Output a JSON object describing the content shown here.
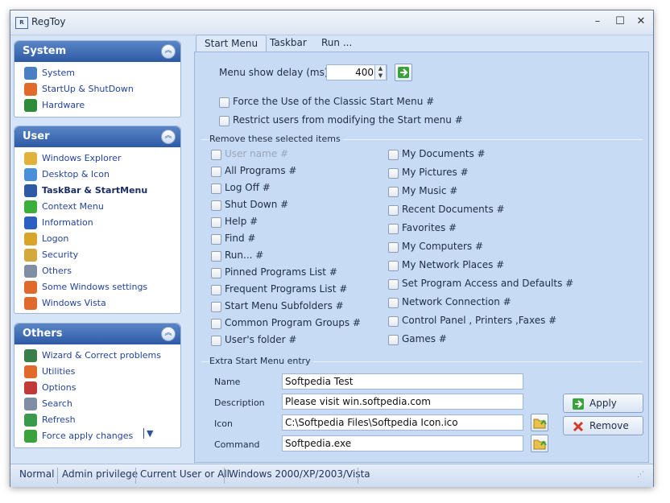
{
  "window": {
    "title": "RegToy",
    "icon_text": "R",
    "controls": {
      "minimize": "–",
      "maximize": "☐",
      "close": "✕"
    }
  },
  "sidebar": {
    "system": {
      "title": "System",
      "items": [
        {
          "label": "System",
          "icon": "computer-icon",
          "color": "#4a7fc4"
        },
        {
          "label": "StartUp & ShutDown",
          "icon": "windows-flag-icon",
          "color": "#e06a2b"
        },
        {
          "label": "Hardware",
          "icon": "circuit-board-icon",
          "color": "#2e8b3a"
        }
      ]
    },
    "user": {
      "title": "User",
      "items": [
        {
          "label": "Windows Explorer",
          "icon": "folder-icon",
          "color": "#e0b23a",
          "bold": false
        },
        {
          "label": "Desktop & Icon",
          "icon": "desktop-icon",
          "color": "#4a90d9",
          "bold": false
        },
        {
          "label": "TaskBar & StartMenu",
          "icon": "taskbar-icon",
          "color": "#2e5aa5",
          "bold": true
        },
        {
          "label": "Context Menu",
          "icon": "plus-icon",
          "color": "#3cae3c",
          "bold": false
        },
        {
          "label": "Information",
          "icon": "info-icon",
          "color": "#2d5ec2",
          "bold": false
        },
        {
          "label": "Logon",
          "icon": "key-icon",
          "color": "#d9a42a",
          "bold": false
        },
        {
          "label": "Security",
          "icon": "lock-icon",
          "color": "#d2a93a",
          "bold": false
        },
        {
          "label": "Others",
          "icon": "gear-icon",
          "color": "#7f8ea3",
          "bold": false
        },
        {
          "label": "Some Windows settings",
          "icon": "windows-logo-icon",
          "color": "#e06a2b",
          "bold": false
        },
        {
          "label": "Windows Vista",
          "icon": "windows-logo-icon",
          "color": "#e06a2b",
          "bold": false
        }
      ]
    },
    "others": {
      "title": "Others",
      "items": [
        {
          "label": "Wizard & Correct problems",
          "icon": "wizard-icon",
          "color": "#3a7f4a"
        },
        {
          "label": "Utilities",
          "icon": "windows-logo-icon",
          "color": "#e06a2b"
        },
        {
          "label": "Options",
          "icon": "options-icon",
          "color": "#c03a3a"
        },
        {
          "label": "Search",
          "icon": "search-icon",
          "color": "#7f8ea3"
        },
        {
          "label": "Refresh",
          "icon": "refresh-icon",
          "color": "#3a9a4a"
        },
        {
          "label": "Force apply changes",
          "icon": "arrow-right-icon",
          "color": "#3aa23a"
        }
      ],
      "dropdown_glyph": "▼"
    }
  },
  "tabs": [
    "Start Menu",
    "Taskbar",
    "Run ..."
  ],
  "main": {
    "menu_delay": {
      "label": "Menu show delay (ms)",
      "value": "400"
    },
    "options": [
      {
        "label": "Force the Use of the Classic Start Menu #"
      },
      {
        "label": "Restrict users from modifying the Start menu #"
      }
    ],
    "remove_group_title": "Remove these selected items",
    "remove_left": [
      {
        "label": "User name #",
        "disabled": true
      },
      {
        "label": "All Programs #"
      },
      {
        "label": "Log Off #"
      },
      {
        "label": "Shut Down #"
      },
      {
        "label": "Help #"
      },
      {
        "label": "Find #"
      },
      {
        "label": "Run... #"
      },
      {
        "label": "Pinned Programs List #"
      },
      {
        "label": "Frequent Programs List #"
      },
      {
        "label": "Start Menu Subfolders #"
      },
      {
        "label": "Common Program Groups #"
      },
      {
        "label": "User's folder #"
      }
    ],
    "remove_right": [
      {
        "label": "My Documents #"
      },
      {
        "label": "My Pictures #"
      },
      {
        "label": "My Music #"
      },
      {
        "label": "Recent Documents #"
      },
      {
        "label": "Favorites #"
      },
      {
        "label": "My Computers #"
      },
      {
        "label": "My Network Places #"
      },
      {
        "label": "Set Program Access and Defaults #"
      },
      {
        "label": "Network Connection #"
      },
      {
        "label": "Control Panel , Printers ,Faxes #"
      },
      {
        "label": "Games #"
      }
    ],
    "extra": {
      "title": "Extra Start Menu entry",
      "name_label": "Name",
      "name_value": "Softpedia Test",
      "desc_label": "Description",
      "desc_value": "Please visit win.softpedia.com",
      "icon_label": "Icon",
      "icon_value": "C:\\Softpedia Files\\Softpedia Icon.ico",
      "command_label": "Command",
      "command_value": "Softpedia.exe",
      "apply_label": "Apply",
      "remove_label": "Remove"
    }
  },
  "statusbar": [
    "Normal",
    "Admin privilege",
    "Current User or All",
    "Windows 2000/XP/2003/Vista"
  ]
}
